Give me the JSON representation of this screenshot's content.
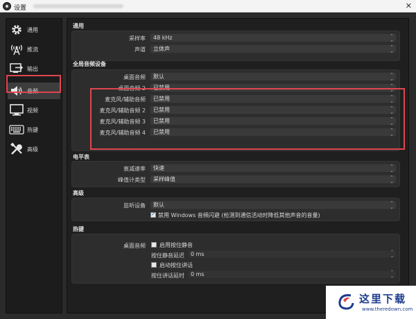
{
  "window": {
    "title": "设置",
    "close_glyph": "✕"
  },
  "sidebar": {
    "items": [
      {
        "label": "通用",
        "icon": "gear-icon"
      },
      {
        "label": "推流",
        "icon": "broadcast-icon"
      },
      {
        "label": "输出",
        "icon": "output-icon"
      },
      {
        "label": "音频",
        "icon": "speaker-icon",
        "selected": true
      },
      {
        "label": "视频",
        "icon": "monitor-icon"
      },
      {
        "label": "热键",
        "icon": "keyboard-icon"
      },
      {
        "label": "高级",
        "icon": "tools-icon"
      }
    ]
  },
  "sections": {
    "general": {
      "title": "通用",
      "sample_rate_label": "采样率",
      "sample_rate_value": "48 kHz",
      "channels_label": "声道",
      "channels_value": "立体声"
    },
    "global_audio": {
      "title": "全局音频设备",
      "desktop1_label": "桌面音频",
      "desktop1_value": "默认",
      "desktop2_label": "桌面音频 2",
      "desktop2_value": "已禁用",
      "mic1_label": "麦克风/辅助音频",
      "mic1_value": "已禁用",
      "mic2_label": "麦克风/辅助音频 2",
      "mic2_value": "已禁用",
      "mic3_label": "麦克风/辅助音频 3",
      "mic3_value": "已禁用",
      "mic4_label": "麦克风/辅助音频 4",
      "mic4_value": "已禁用"
    },
    "meters": {
      "title": "电平表",
      "decay_label": "衰减速率",
      "decay_value": "快速",
      "peak_label": "峰值计类型",
      "peak_value": "采样峰值"
    },
    "advanced": {
      "title": "高级",
      "monitor_label": "监听设备",
      "monitor_value": "默认",
      "ducking_label": "禁用 Windows 音频闪避 (检测到通信活动时降低其他声音的音量)",
      "ducking_checked": true
    },
    "hotkeys": {
      "title": "热键",
      "desktop_label": "桌面音频",
      "ptm_enable_label": "启用按住静音",
      "ptm_delay_label": "按住静音延迟",
      "ptm_delay_value": "0 ms",
      "ptt_enable_label": "启动按住讲话",
      "ptt_delay_label": "按住讲话延时",
      "ptt_delay_value": "0 ms"
    }
  },
  "watermark": {
    "text": "这里下载",
    "url": "www.theredown.com"
  }
}
